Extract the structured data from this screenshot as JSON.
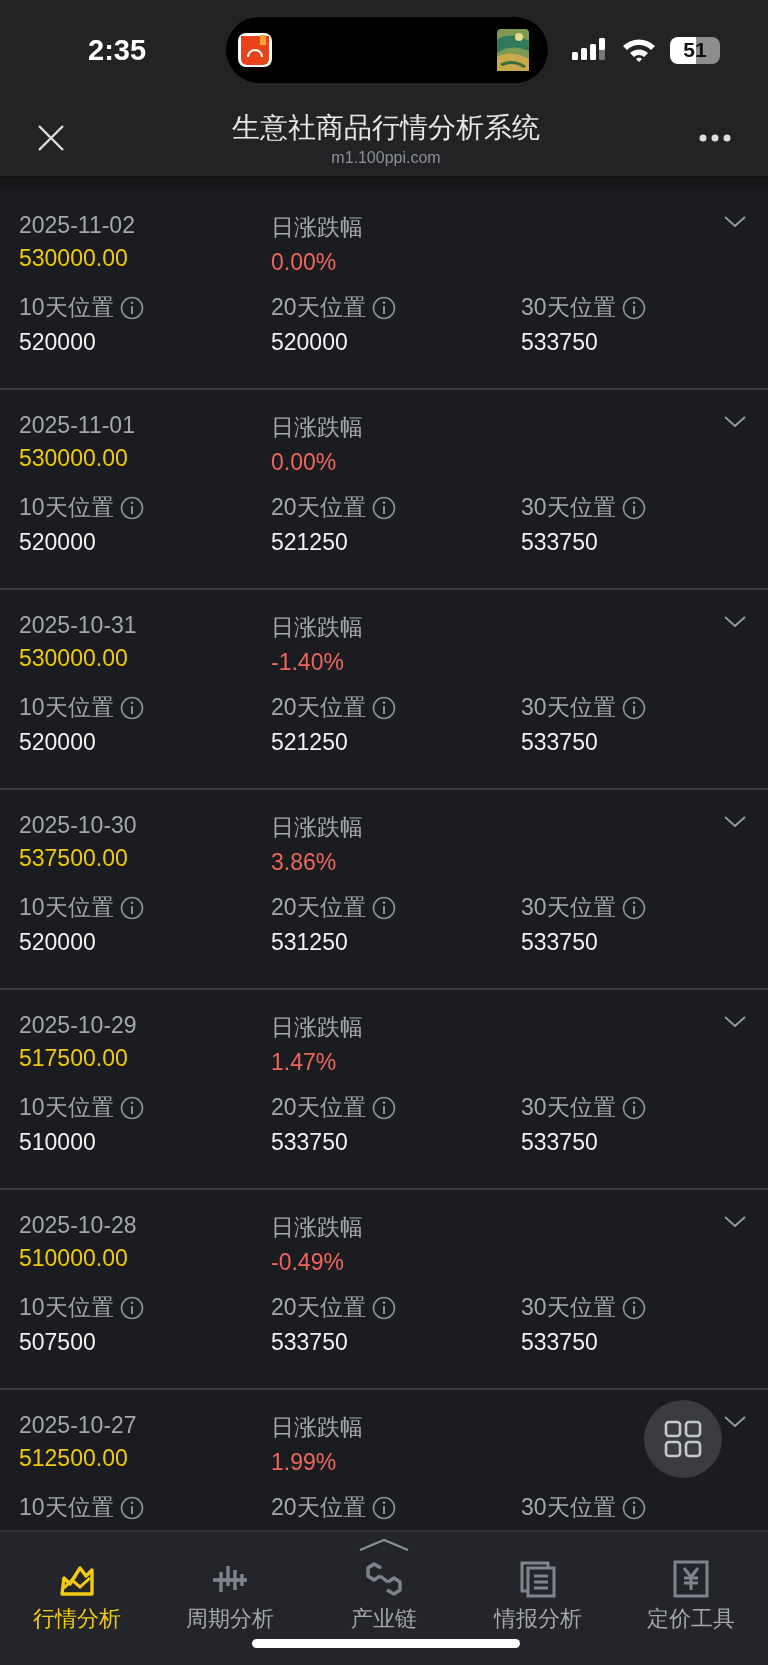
{
  "status_bar": {
    "time": "2:35",
    "battery": "51"
  },
  "header": {
    "title": "生意社商品行情分析系统",
    "url": "m1.100ppi.com"
  },
  "records": [
    {
      "date": "2025-11-02",
      "price": "530000.00",
      "change_label": "日涨跌幅",
      "change": "0.00%",
      "positions": [
        {
          "label": "10天位置",
          "value": "520000"
        },
        {
          "label": "20天位置",
          "value": "520000"
        },
        {
          "label": "30天位置",
          "value": "533750"
        }
      ]
    },
    {
      "date": "2025-11-01",
      "price": "530000.00",
      "change_label": "日涨跌幅",
      "change": "0.00%",
      "positions": [
        {
          "label": "10天位置",
          "value": "520000"
        },
        {
          "label": "20天位置",
          "value": "521250"
        },
        {
          "label": "30天位置",
          "value": "533750"
        }
      ]
    },
    {
      "date": "2025-10-31",
      "price": "530000.00",
      "change_label": "日涨跌幅",
      "change": "-1.40%",
      "positions": [
        {
          "label": "10天位置",
          "value": "520000"
        },
        {
          "label": "20天位置",
          "value": "521250"
        },
        {
          "label": "30天位置",
          "value": "533750"
        }
      ]
    },
    {
      "date": "2025-10-30",
      "price": "537500.00",
      "change_label": "日涨跌幅",
      "change": "3.86%",
      "positions": [
        {
          "label": "10天位置",
          "value": "520000"
        },
        {
          "label": "20天位置",
          "value": "531250"
        },
        {
          "label": "30天位置",
          "value": "533750"
        }
      ]
    },
    {
      "date": "2025-10-29",
      "price": "517500.00",
      "change_label": "日涨跌幅",
      "change": "1.47%",
      "positions": [
        {
          "label": "10天位置",
          "value": "510000"
        },
        {
          "label": "20天位置",
          "value": "533750"
        },
        {
          "label": "30天位置",
          "value": "533750"
        }
      ]
    },
    {
      "date": "2025-10-28",
      "price": "510000.00",
      "change_label": "日涨跌幅",
      "change": "-0.49%",
      "positions": [
        {
          "label": "10天位置",
          "value": "507500"
        },
        {
          "label": "20天位置",
          "value": "533750"
        },
        {
          "label": "30天位置",
          "value": "533750"
        }
      ]
    },
    {
      "date": "2025-10-27",
      "price": "512500.00",
      "change_label": "日涨跌幅",
      "change": "1.99%",
      "positions": [
        {
          "label": "10天位置"
        },
        {
          "label": "20天位置"
        },
        {
          "label": "30天位置"
        }
      ]
    }
  ],
  "tabs": [
    {
      "label": "行情分析",
      "kind": "trend",
      "selected": true
    },
    {
      "label": "周期分析",
      "kind": "cycle",
      "selected": false
    },
    {
      "label": "产业链",
      "kind": "chain",
      "selected": false
    },
    {
      "label": "情报分析",
      "kind": "report",
      "selected": false
    },
    {
      "label": "定价工具",
      "kind": "pricing",
      "selected": false
    }
  ]
}
